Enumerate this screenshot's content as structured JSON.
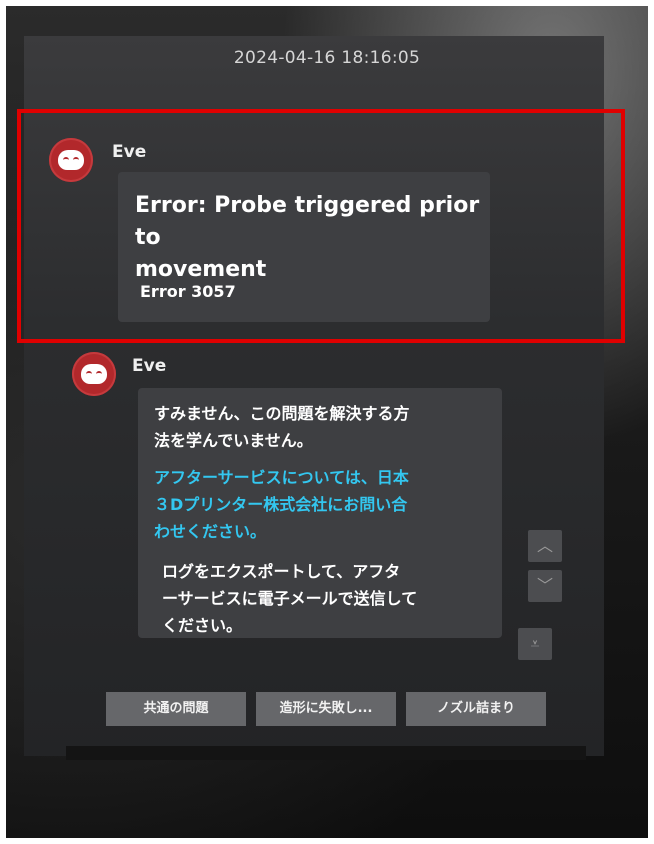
{
  "timestamp": "2024-04-16 18:16:05",
  "messages": [
    {
      "sender": "Eve",
      "title": "Error: Probe triggered prior to movement",
      "title_line1": "Error: Probe triggered prior to",
      "title_line2": "movement",
      "code": "Error 3057"
    },
    {
      "sender": "Eve",
      "line1": "すみません、この問題を解決する方",
      "line2": "法を学んでいません。",
      "cyan1": "アフターサービスについては、日本",
      "cyan2": "３Dプリンター株式会社にお問い合",
      "cyan3": "わせください。",
      "line3": "ログをエクスポートして、アフタ",
      "line4": "ーサービスに電子メールで送信して",
      "line5": "ください。"
    }
  ],
  "scroll": {
    "up": "︿",
    "down": "﹀",
    "bottom": "⩡"
  },
  "quick_replies": [
    "共通の問題",
    "造形に失敗し...",
    "ノズル詰まり"
  ],
  "icons": {
    "avatar": "robot-face-icon"
  },
  "colors": {
    "highlight": "#e00000",
    "link": "#33c7f0",
    "avatar": "#b2282b"
  }
}
